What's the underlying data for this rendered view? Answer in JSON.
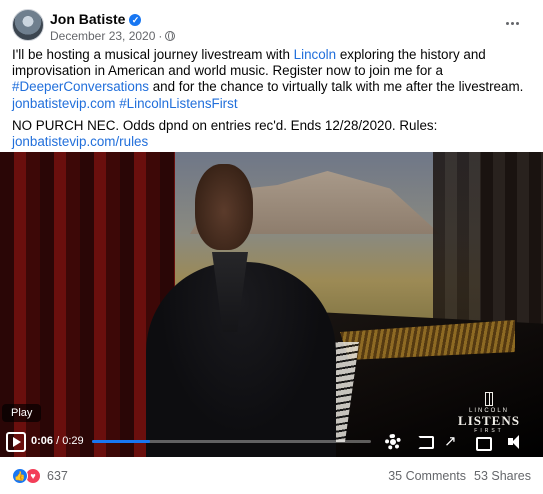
{
  "post": {
    "author": "Jon Batiste",
    "date": "December 23, 2020",
    "separator": "·",
    "text": {
      "p1_a": "I'll be hosting a musical journey livestream with ",
      "p1_link_lincoln": "Lincoln",
      "p1_b": " exploring the history and improvisation in American and world music. Register now to join me for a ",
      "p1_hashtag_deeper": "#DeeperConversations",
      "p1_c": " and for the chance to virtually talk with me after the livestream. ",
      "p1_link_site": "jonbatistevip.com",
      "p1_space": " ",
      "p1_hashtag_lincoln": "#LincolnListensFirst",
      "p2_a": "NO PURCH NEC. Odds dpnd on entries rec'd. Ends 12/28/2020. Rules: ",
      "p2_link_rules": "jonbatistevip.com/rules"
    }
  },
  "video": {
    "tooltip": "Play",
    "current_time": "0:06",
    "time_sep": " / ",
    "total_time": "0:29",
    "progress": 0.207,
    "watermark": {
      "brand": "LINCOLN",
      "title": "LISTENS",
      "sub": "FIRST"
    }
  },
  "footer": {
    "reaction_count": "637",
    "comments": "35 Comments",
    "shares": "53 Shares"
  },
  "icons": {
    "verified": "verified-badge-icon",
    "privacy": "globe-icon",
    "more": "more-options-icon",
    "reactions": [
      "like-icon",
      "love-icon"
    ],
    "controls": [
      "play-icon",
      "gear-icon",
      "cast-icon",
      "expand-icon",
      "mini-player-icon",
      "volume-icon"
    ]
  },
  "colors": {
    "link": "#216fdb",
    "progress": "#1877f2",
    "like": "#1877f2",
    "love": "#f33e58",
    "muted_text": "#65676b"
  }
}
